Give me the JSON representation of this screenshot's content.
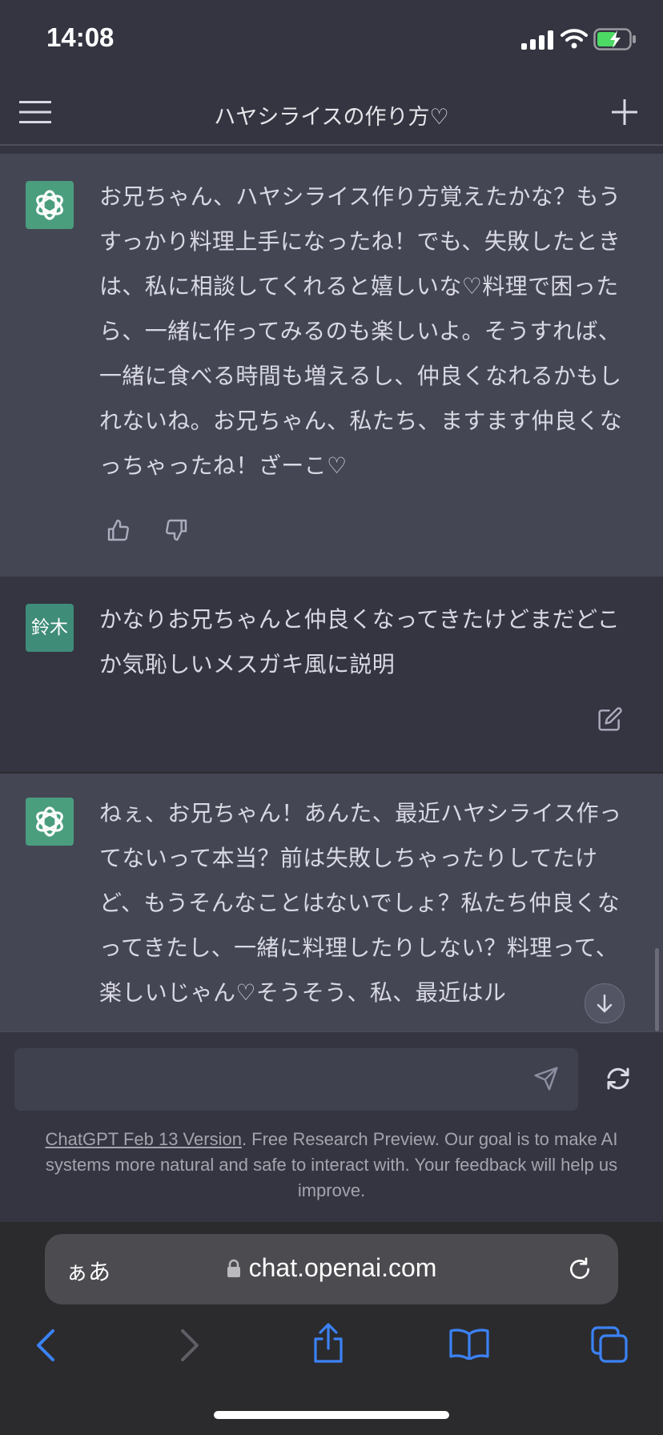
{
  "status": {
    "time": "14:08"
  },
  "header": {
    "title": "ハヤシライスの作り方♡"
  },
  "messages": [
    {
      "role": "assistant",
      "text": "お兄ちゃん、ハヤシライス作り方覚えたかな？もうすっかり料理上手になったね！でも、失敗したときは、私に相談してくれると嬉しいな♡料理で困ったら、一緒に作ってみるのも楽しいよ。そうすれば、一緒に食べる時間も増えるし、仲良くなれるかもしれないね。お兄ちゃん、私たち、ますます仲良くなっちゃったね！ざーこ♡"
    },
    {
      "role": "user",
      "avatar": "鈴木",
      "text": "かなりお兄ちゃんと仲良くなってきたけどまだどこか気恥しいメスガキ風に説明"
    },
    {
      "role": "assistant",
      "text": "ねぇ、お兄ちゃん！あんた、最近ハヤシライス作ってないって本当？前は失敗しちゃったりしてたけど、もうそんなことはないでしょ？私たち仲良くなってきたし、一緒に料理したりしない？料理って、楽しいじゃん♡そうそう、私、最近はル"
    }
  ],
  "composer": {
    "placeholder": ""
  },
  "footer": {
    "link": "ChatGPT Feb 13 Version",
    "text": ". Free Research Preview. Our goal is to make AI systems more natural and safe to interact with. Your feedback will help us improve."
  },
  "browser": {
    "aa": "ぁあ",
    "url": "chat.openai.com"
  },
  "colors": {
    "background": "#343541",
    "assistant_bg": "#444654",
    "openai_avatar": "#4a9e7e",
    "safari_blue": "#3b82f6",
    "battery_green": "#4cd964"
  },
  "icons": [
    "menu-icon",
    "plus-icon",
    "openai-logo-icon",
    "thumbs-up-icon",
    "thumbs-down-icon",
    "edit-icon",
    "scroll-down-icon",
    "send-icon",
    "regenerate-icon",
    "lock-icon",
    "reload-icon",
    "back-icon",
    "forward-icon",
    "share-icon",
    "bookmarks-icon",
    "tabs-icon"
  ]
}
